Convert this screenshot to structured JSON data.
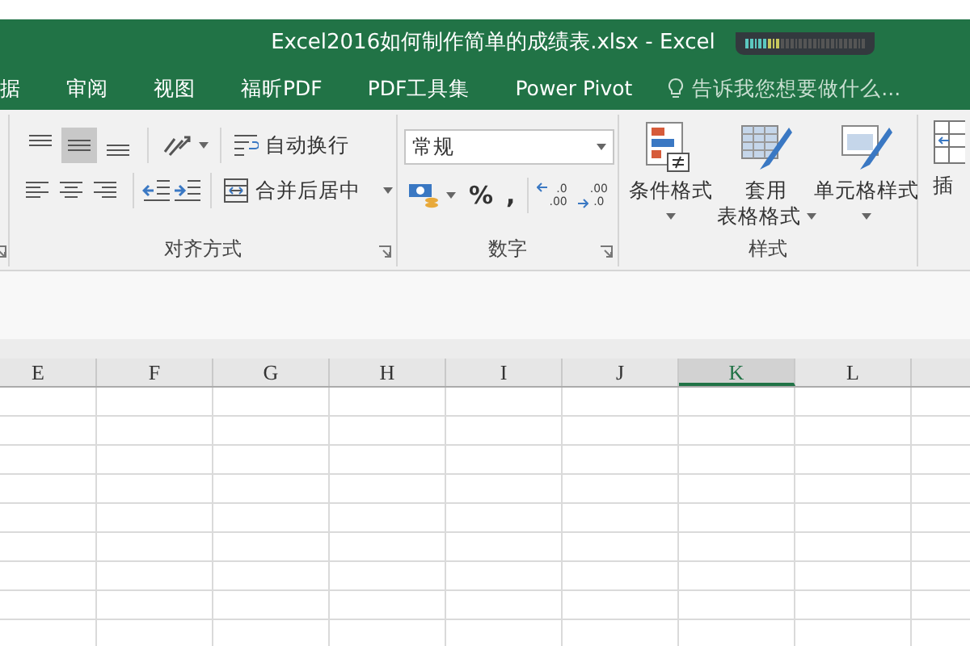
{
  "window": {
    "title": "Excel2016如何制作简单的成绩表.xlsx - Excel"
  },
  "tabs": [
    {
      "label": "据",
      "selected": false
    },
    {
      "label": "审阅",
      "selected": false
    },
    {
      "label": "视图",
      "selected": false
    },
    {
      "label": "福昕PDF",
      "selected": false
    },
    {
      "label": "PDF工具集",
      "selected": false
    },
    {
      "label": "Power Pivot",
      "selected": false
    }
  ],
  "tell_me": {
    "placeholder": "告诉我您想要做什么..."
  },
  "alignment": {
    "label": "对齐方式",
    "vertical_align": [
      {
        "selected": false
      },
      {
        "selected": true
      },
      {
        "selected": false
      }
    ],
    "wrap_text": "自动换行",
    "merge_center": "合并后居中"
  },
  "number": {
    "label": "数字",
    "format": "常规",
    "percent": "%",
    "comma": ",",
    "decimal_buttons": [
      {
        "top": ".0",
        "bottom": ".00"
      },
      {
        "top": ".00",
        "bottom": ".0"
      }
    ]
  },
  "styles": {
    "label": "样式",
    "buttons": [
      {
        "lines": [
          "条件格式"
        ]
      },
      {
        "lines": [
          "套用",
          "表格格式"
        ]
      },
      {
        "lines": [
          "单元格样式"
        ]
      }
    ]
  },
  "cells": {
    "insert": "插"
  },
  "sheet": {
    "columns": [
      {
        "label": "E",
        "selected": false
      },
      {
        "label": "F",
        "selected": false
      },
      {
        "label": "G",
        "selected": false
      },
      {
        "label": "H",
        "selected": false
      },
      {
        "label": "I",
        "selected": false
      },
      {
        "label": "J",
        "selected": false
      },
      {
        "label": "K",
        "selected": true
      },
      {
        "label": "L",
        "selected": false
      }
    ]
  }
}
